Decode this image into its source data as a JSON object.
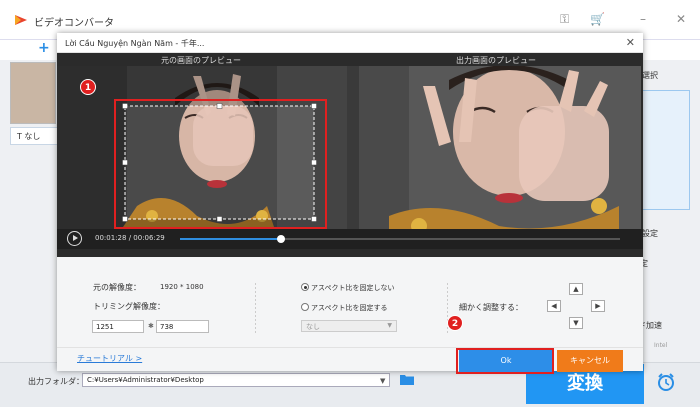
{
  "app": {
    "title": "ビデオコンバータ",
    "add_label": "+",
    "subtitle_label": "T なし",
    "right_labels": [
      "定選択",
      "設定",
      "定",
      "ド加速",
      "Intel"
    ],
    "output_folder_label": "出力フォルダ：",
    "output_folder_path": "C:¥Users¥Administrator¥Desktop",
    "convert_label": "変換"
  },
  "dialog": {
    "title": "Lời Cầu Nguyện Ngàn Năm - 千年...",
    "original_preview_label": "元の画面のプレビュー",
    "output_preview_label": "出力画面のプレビュー",
    "time_current": "00:01:28",
    "time_total": "00:06:29",
    "time_separator": "/",
    "progress": 0.23,
    "original_resolution_label": "元の解像度：",
    "original_resolution_value": "1920 * 1080",
    "trim_resolution_label": "トリミング解像度：",
    "trim_width": "1251",
    "trim_height": "738",
    "trim_times": "✱",
    "aspect_unlocked_label": "アスペクト比を固定しない",
    "aspect_locked_label": "アスペクト比を固定する",
    "aspect_select_value": "なし",
    "fine_adjust_label": "細かく調整する：",
    "tutorial_label": "チュートリアル >",
    "ok_label": "Ok",
    "cancel_label": "キャンセル"
  },
  "annotations": {
    "badge1": "1",
    "badge2": "2"
  },
  "colors": {
    "accent": "#2d8ee8",
    "cancel": "#f07b1a",
    "annotation": "#e02020"
  }
}
